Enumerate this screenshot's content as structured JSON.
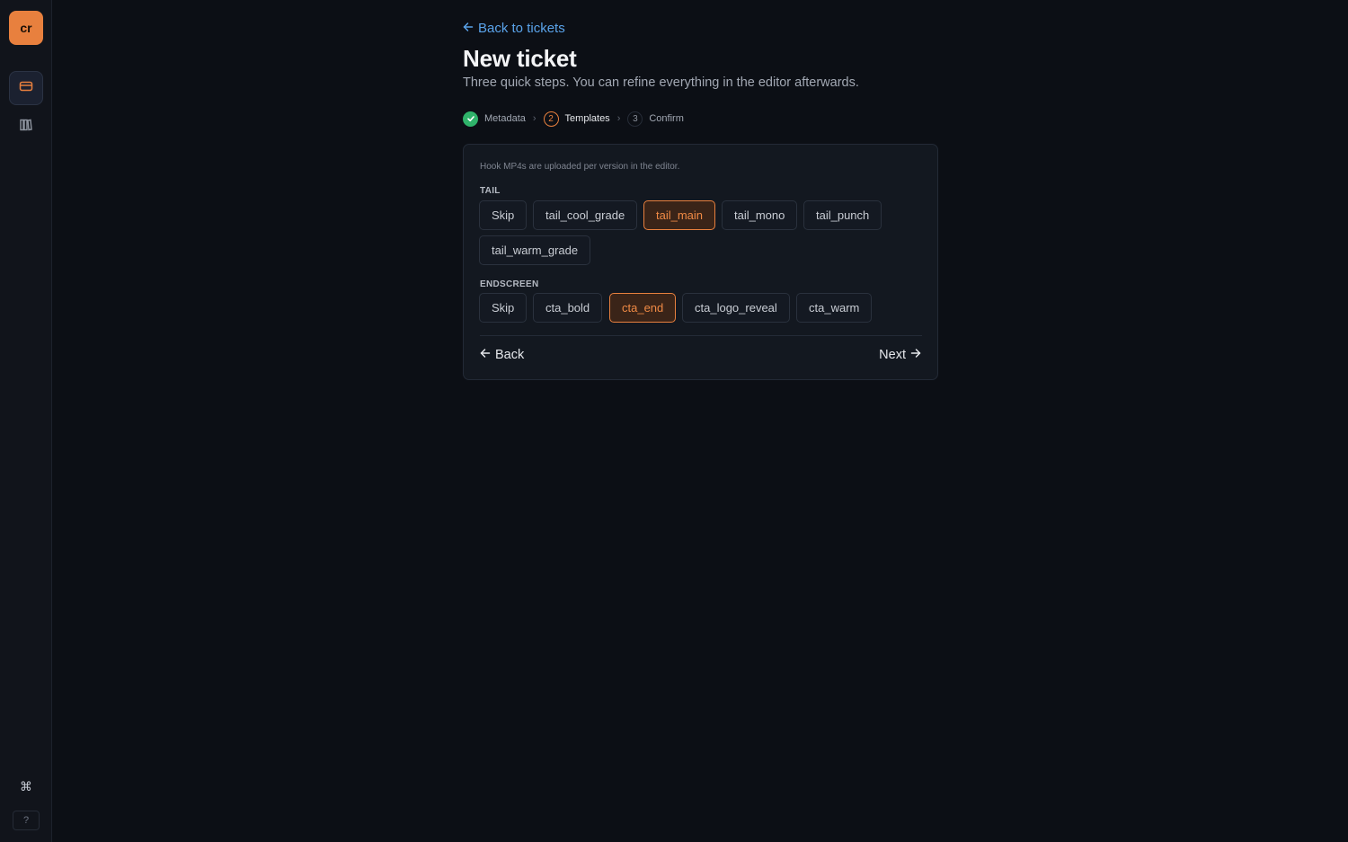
{
  "sidebar": {
    "logo_text": "cr",
    "items": [
      {
        "icon": "ticket-icon",
        "active": true
      },
      {
        "icon": "library-icon",
        "active": false
      }
    ],
    "command_icon": "command-icon",
    "help_label": "?"
  },
  "header": {
    "back_link": "Back to tickets",
    "title": "New ticket",
    "subtitle": "Three quick steps. You can refine everything in the editor afterwards."
  },
  "stepper": {
    "steps": [
      {
        "number": "1",
        "label": "Metadata",
        "state": "done"
      },
      {
        "number": "2",
        "label": "Templates",
        "state": "current"
      },
      {
        "number": "3",
        "label": "Confirm",
        "state": "pending"
      }
    ],
    "separator": "›"
  },
  "card": {
    "hint": "Hook MP4s are uploaded per version in the editor.",
    "tail": {
      "label": "TAIL",
      "options": [
        "Skip",
        "tail_cool_grade",
        "tail_main",
        "tail_mono",
        "tail_punch",
        "tail_warm_grade"
      ],
      "selected": "tail_main"
    },
    "endscreen": {
      "label": "ENDSCREEN",
      "options": [
        "Skip",
        "cta_bold",
        "cta_end",
        "cta_logo_reveal",
        "cta_warm"
      ],
      "selected": "cta_end"
    },
    "back_label": "Back",
    "next_label": "Next"
  },
  "colors": {
    "accent": "#e8803e",
    "link": "#5aa3ea",
    "success": "#2fb36a",
    "background": "#0c0f15"
  }
}
